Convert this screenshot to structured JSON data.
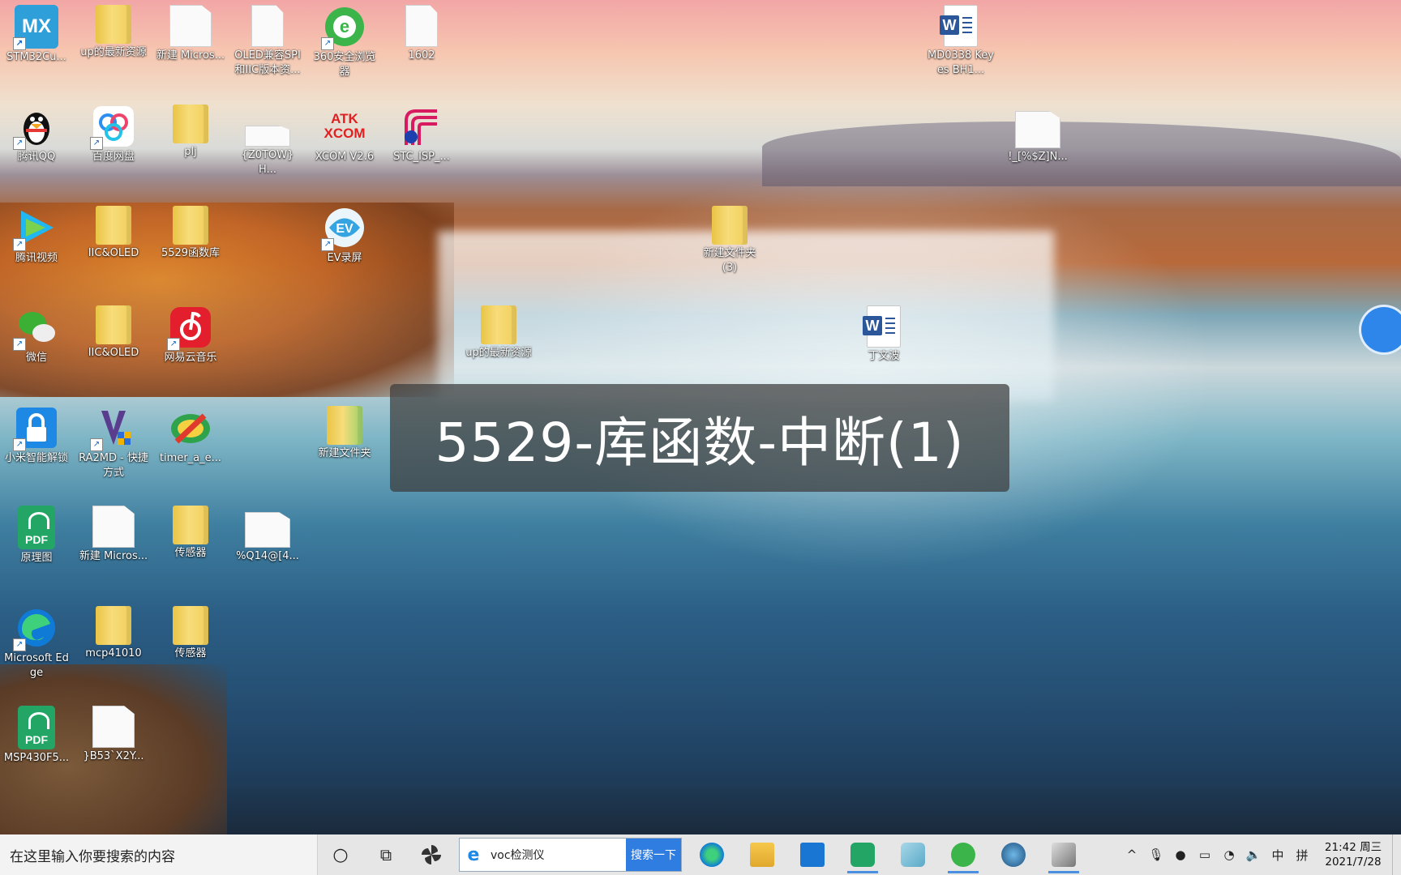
{
  "overlay_title": "5529-库函数-中断(1)",
  "desktop_icons": [
    {
      "label": "STM32Cu...",
      "kind": "tile",
      "color": "#2e9fd9",
      "text": "MX"
    },
    {
      "label": "up的最新资源",
      "kind": "folder"
    },
    {
      "label": "新建 Micros...",
      "kind": "doc"
    },
    {
      "label": "OLED兼容SPI和IIC版本资...",
      "kind": "doc"
    },
    {
      "label": "360安全浏览器",
      "kind": "browser360"
    },
    {
      "label": "1602",
      "kind": "doc"
    },
    {
      "label": "MD0338 Keyes BH1...",
      "kind": "word"
    },
    {
      "label": "腾讯QQ",
      "kind": "qq"
    },
    {
      "label": "百度网盘",
      "kind": "baidu"
    },
    {
      "label": "plj",
      "kind": "folder"
    },
    {
      "label": "{Z0TOW}H...",
      "kind": "doc"
    },
    {
      "label": "XCOM V2.6",
      "kind": "xcom",
      "text": "ATK XCOM"
    },
    {
      "label": "STC_ISP_...",
      "kind": "stc"
    },
    {
      "label": "!_[%$Z]N...",
      "kind": "doc"
    },
    {
      "label": "腾讯视频",
      "kind": "video"
    },
    {
      "label": "IIC&OLED",
      "kind": "folder"
    },
    {
      "label": "5529函数库",
      "kind": "folder"
    },
    {
      "label": "EV录屏",
      "kind": "ev"
    },
    {
      "label": "新建文件夹 (3)",
      "kind": "folder"
    },
    {
      "label": "微信",
      "kind": "wechat"
    },
    {
      "label": "IIC&OLED",
      "kind": "folder"
    },
    {
      "label": "网易云音乐",
      "kind": "netease"
    },
    {
      "label": "up的最新资源",
      "kind": "folder"
    },
    {
      "label": "丁文波",
      "kind": "word"
    },
    {
      "label": "小米智能解锁",
      "kind": "lock"
    },
    {
      "label": "RA2MD - 快捷方式",
      "kind": "ra2"
    },
    {
      "label": "timer_a_e...",
      "kind": "timer"
    },
    {
      "label": "新建文件夹",
      "kind": "folder"
    },
    {
      "label": "原理图",
      "kind": "pdf"
    },
    {
      "label": "新建 Micros...",
      "kind": "doc"
    },
    {
      "label": "传感器",
      "kind": "folder"
    },
    {
      "label": "%Q14@[4...",
      "kind": "doc"
    },
    {
      "label": "Microsoft Edge",
      "kind": "edge"
    },
    {
      "label": "mcp41010",
      "kind": "folder"
    },
    {
      "label": "传感器",
      "kind": "folder"
    },
    {
      "label": "MSP430F5...",
      "kind": "pdf"
    },
    {
      "label": "}B53`X2Y...",
      "kind": "doc"
    }
  ],
  "taskbar": {
    "search_placeholder": "在这里输入你要搜索的内容",
    "browser_query": "voc检测仪",
    "browser_go": "搜索一下",
    "ime_lang": "中",
    "ime_mode": "拼",
    "time": "21:42 周三",
    "date": "2021/7/28"
  }
}
